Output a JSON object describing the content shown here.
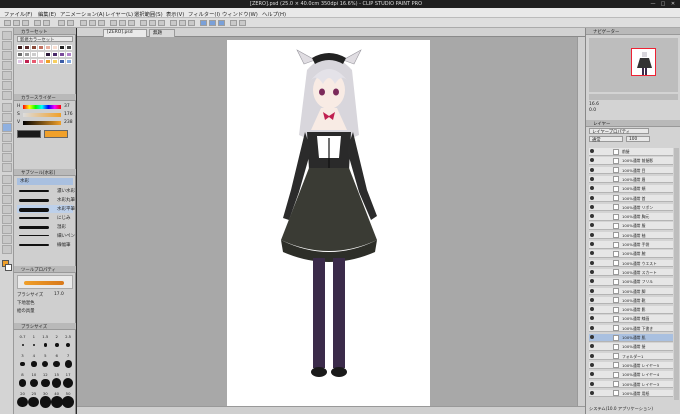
{
  "window": {
    "title": "[ZERO].psd (25.0 × 40.0cm 350dpi 16.6%) - CLIP STUDIO PAINT PRO"
  },
  "menu": [
    "ファイル(F)",
    "編集(E)",
    "アニメーション(A)",
    "レイヤー(L)",
    "選択範囲(S)",
    "表示(V)",
    "フィルター(I)",
    "ウィンドウ(W)",
    "ヘルプ(H)"
  ],
  "left_panel": {
    "color_set_header": "カラーセット",
    "color_set_name": "新規カラーセット",
    "color_slider_header": "カラースライダー",
    "sliders": [
      {
        "label": "H",
        "value": "37"
      },
      {
        "label": "S",
        "value": "176"
      },
      {
        "label": "V",
        "value": "238"
      }
    ],
    "subtool_header": "サブツール[水彩]",
    "subtool_group": "水彩",
    "brushes": [
      "濃い水彩",
      "水彩丸筆",
      "水彩平筆",
      "にじみ",
      "湿彩",
      "細いペン",
      "線幅筆"
    ],
    "tool_property_header": "ツールプロパティ",
    "prop_labels": [
      "ブラシサイズ",
      "下地混色",
      "絵の具量"
    ],
    "prop_values": [
      "17.0"
    ],
    "brush_size_header": "ブラシサイズ",
    "size_values": [
      "0.7",
      "1",
      "1.5",
      "2",
      "2.5",
      "3",
      "4",
      "5",
      "6",
      "7",
      "8",
      "10",
      "12",
      "15",
      "17",
      "20",
      "25",
      "30",
      "40",
      "50"
    ]
  },
  "canvas": {
    "tabs": [
      "[ZERO].psd",
      "無題"
    ]
  },
  "right_panel": {
    "nav_header": "ナビゲーター",
    "zoom_value": "16.6",
    "angle_value": "0.0",
    "layer_panel_header": "レイヤー",
    "layer_header_prop": "レイヤープロパティ",
    "blend_mode": "通常",
    "opacity": "100",
    "layers": [
      "前髪",
      "100%通常 前髪影",
      "100%通常 目",
      "100%通常 眉",
      "100%通常 頬",
      "100%通常 首",
      "100%通常 リボン",
      "100%通常 胸元",
      "100%通常 服",
      "100%通常 袖",
      "100%通常 手袋",
      "100%通常 腕",
      "100%通常 ウエスト",
      "100%通常 スカート",
      "100%通常 フリル",
      "100%通常 脚",
      "100%通常 靴",
      "100%通常 影",
      "100%通常 線画",
      "100%通常 下書き",
      "100%通常 肌",
      "100%通常 髪",
      "フォルダー1",
      "100%通常 レイヤー5",
      "100%通常 レイヤー4",
      "100%通常 レイヤー3",
      "100%通常 用紙"
    ],
    "bottom_text": "システム(10.0 アプリケーション)"
  },
  "colors": {
    "accent": "#3c5ea8",
    "selected_layer": "#a9c0e0",
    "main_color": "#f0a02a"
  }
}
